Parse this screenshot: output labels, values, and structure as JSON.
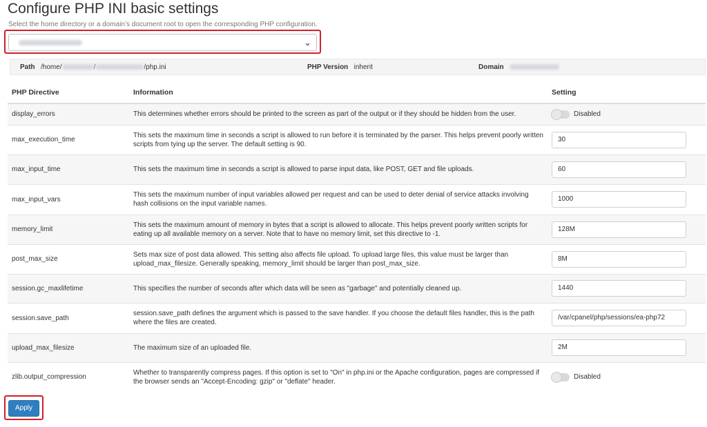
{
  "page": {
    "title": "Configure PHP INI basic settings",
    "subtitle": "Select the home directory or a domain’s document root to open the corresponding PHP configuration."
  },
  "info": {
    "path_label": "Path",
    "path_prefix": "/home/",
    "path_sep": "/",
    "path_suffix": "/php.ini",
    "version_label": "PHP Version",
    "version_value": "inherit",
    "domain_label": "Domain"
  },
  "table": {
    "headers": [
      "PHP Directive",
      "Information",
      "Setting"
    ],
    "rows": [
      {
        "directive": "display_errors",
        "info": "This determines whether errors should be printed to the screen as part of the output or if they should be hidden from the user.",
        "type": "toggle",
        "value": "Disabled"
      },
      {
        "directive": "max_execution_time",
        "info": "This sets the maximum time in seconds a script is allowed to run before it is terminated by the parser. This helps prevent poorly written scripts from tying up the server. The default setting is 90.",
        "type": "text",
        "value": "30"
      },
      {
        "directive": "max_input_time",
        "info": "This sets the maximum time in seconds a script is allowed to parse input data, like POST, GET and file uploads.",
        "type": "text",
        "value": "60"
      },
      {
        "directive": "max_input_vars",
        "info": "This sets the maximum number of input variables allowed per request and can be used to deter denial of service attacks involving hash collisions on the input variable names.",
        "type": "text",
        "value": "1000"
      },
      {
        "directive": "memory_limit",
        "info": "This sets the maximum amount of memory in bytes that a script is allowed to allocate. This helps prevent poorly written scripts for eating up all available memory on a server. Note that to have no memory limit, set this directive to -1.",
        "type": "text",
        "value": "128M"
      },
      {
        "directive": "post_max_size",
        "info": "Sets max size of post data allowed. This setting also affects file upload. To upload large files, this value must be larger than upload_max_filesize. Generally speaking, memory_limit should be larger than post_max_size.",
        "type": "text",
        "value": "8M"
      },
      {
        "directive": "session.gc_maxlifetime",
        "info": "This specifies the number of seconds after which data will be seen as \"garbage\" and potentially cleaned up.",
        "type": "text",
        "value": "1440"
      },
      {
        "directive": "session.save_path",
        "info": "session.save_path defines the argument which is passed to the save handler. If you choose the default files handler, this is the path where the files are created.",
        "type": "text",
        "value": "/var/cpanel/php/sessions/ea-php72"
      },
      {
        "directive": "upload_max_filesize",
        "info": "The maximum size of an uploaded file.",
        "type": "text",
        "value": "2M"
      },
      {
        "directive": "zlib.output_compression",
        "info": "Whether to transparently compress pages. If this option is set to \"On\" in php.ini or the Apache configuration, pages are compressed if the browser sends an \"Accept-Encoding: gzip\" or \"deflate\" header.",
        "type": "toggle",
        "value": "Disabled"
      }
    ]
  },
  "actions": {
    "apply_label": "Apply"
  },
  "colors": {
    "primary_button": "#2f7ec0",
    "highlight_border": "#d0202a",
    "row_stripe": "#f6f6f6"
  },
  "icons": {
    "select_caret": "chevron-down-icon"
  }
}
